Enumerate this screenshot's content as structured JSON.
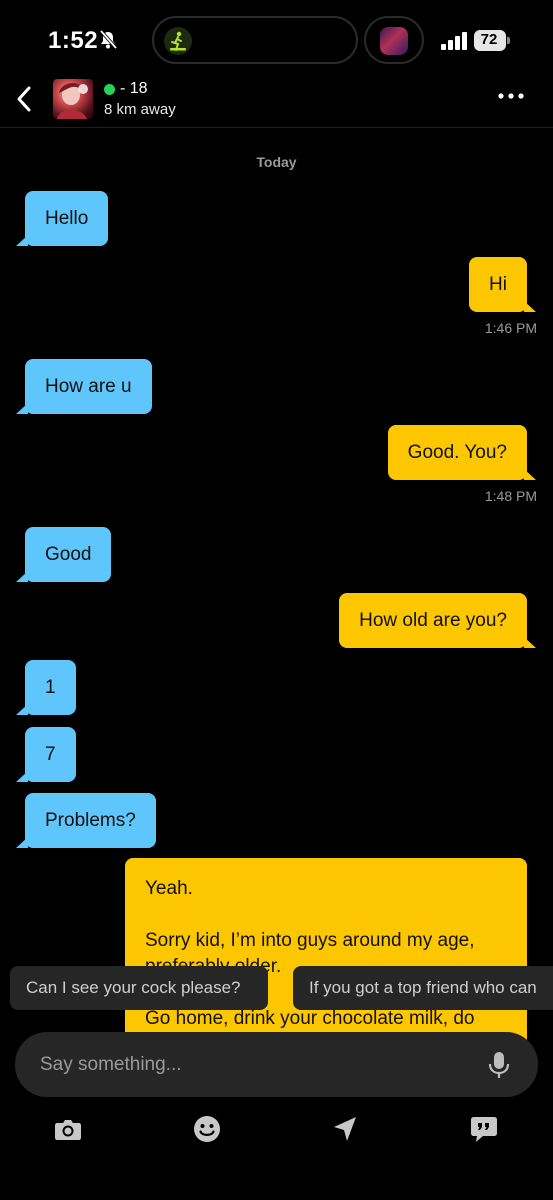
{
  "status_bar": {
    "time": "1:52",
    "battery": "72"
  },
  "header": {
    "age": "- 18",
    "distance": "8 km away"
  },
  "conversation": {
    "date_label": "Today",
    "messages": [
      {
        "side": "in",
        "text": "Hello"
      },
      {
        "side": "out",
        "text": "Hi",
        "time": "1:46 PM"
      },
      {
        "side": "in",
        "text": "How are u"
      },
      {
        "side": "out",
        "text": "Good. You?",
        "time": "1:48 PM"
      },
      {
        "side": "in",
        "text": "Good"
      },
      {
        "side": "out",
        "text": "How old are you?"
      },
      {
        "side": "in",
        "text": "1"
      },
      {
        "side": "in",
        "text": "7"
      },
      {
        "side": "in",
        "text": "Problems?"
      }
    ],
    "long_message": {
      "line1": "Yeah.",
      "line2": "Sorry kid, I’m into guys around my age, preferably older.",
      "line3": "Go home, drink your chocolate milk, do"
    }
  },
  "suggestions": [
    "Can I see your cock please?",
    "If you got a top friend who can"
  ],
  "composer": {
    "placeholder": "Say something..."
  },
  "colors": {
    "incoming_bubble": "#5ec6fb",
    "outgoing_bubble": "#fdc700",
    "online": "#26d35a"
  }
}
